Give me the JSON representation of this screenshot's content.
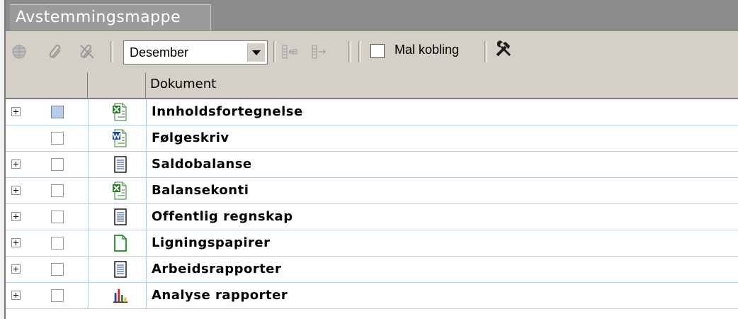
{
  "tab": {
    "label": "Avstemmingsmappe"
  },
  "toolbar": {
    "period": "Desember",
    "mal_kobling_label": "Mal kobling",
    "mal_kobling_checked": false,
    "icons": [
      "globe-icon",
      "attach-icon",
      "detach-icon",
      "move-left-icon",
      "move-right-icon",
      "tools-icon"
    ]
  },
  "grid": {
    "column_header": "Dokument",
    "rows": [
      {
        "name": "Innholdsfortegnelse",
        "icon": "excel-doc-icon",
        "expandable": true,
        "selected": true
      },
      {
        "name": "Følgeskriv",
        "icon": "word-doc-icon",
        "expandable": false,
        "selected": false
      },
      {
        "name": "Saldobalanse",
        "icon": "text-doc-icon",
        "expandable": true,
        "selected": false
      },
      {
        "name": "Balansekonti",
        "icon": "excel-doc-icon",
        "expandable": true,
        "selected": false
      },
      {
        "name": "Offentlig regnskap",
        "icon": "text-doc-icon",
        "expandable": true,
        "selected": false
      },
      {
        "name": "Ligningspapirer",
        "icon": "blank-doc-icon",
        "expandable": true,
        "selected": false
      },
      {
        "name": "Arbeidsrapporter",
        "icon": "text-doc-icon",
        "expandable": true,
        "selected": false
      },
      {
        "name": "Analyse rapporter",
        "icon": "bar-chart-icon",
        "expandable": true,
        "selected": false
      }
    ]
  }
}
